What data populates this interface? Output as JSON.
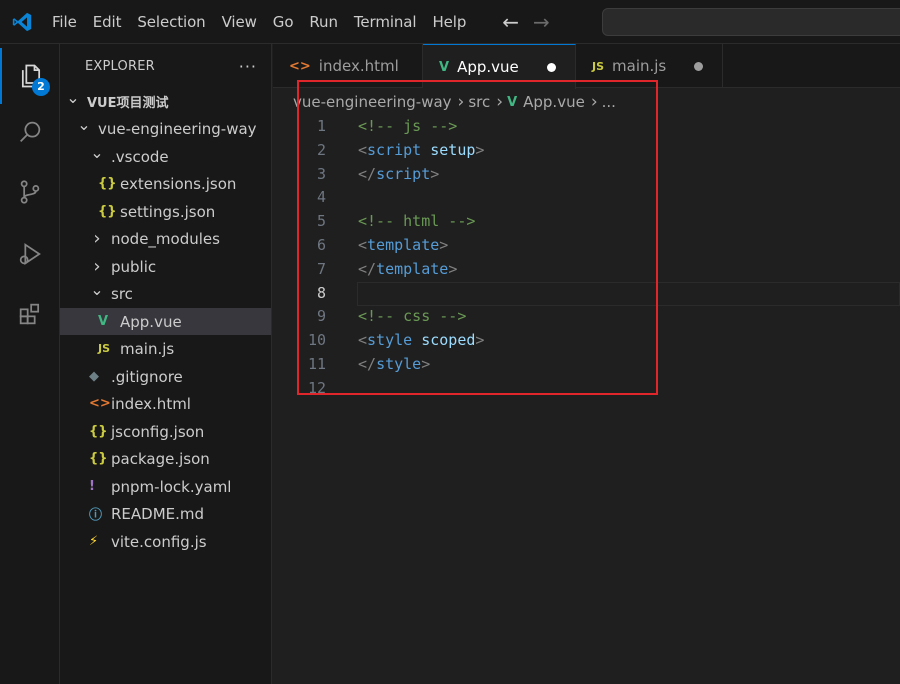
{
  "colors": {
    "accent": "#0078d4",
    "vue": "#41b883",
    "js": "#cbcb41",
    "html": "#e37933",
    "json": "#cbcb41",
    "annotation": "#e0262b"
  },
  "menu": [
    "File",
    "Edit",
    "Selection",
    "View",
    "Go",
    "Run",
    "Terminal",
    "Help"
  ],
  "activity": {
    "explorer_badge": "2",
    "icons": [
      "files-icon",
      "search-icon",
      "source-control-icon",
      "run-debug-icon",
      "extensions-icon"
    ]
  },
  "sidebar": {
    "title": "EXPLORER",
    "more": "···",
    "tree": [
      {
        "label": "VUE项目测试",
        "chevron": "down",
        "icon": "",
        "depth": 0,
        "root": true
      },
      {
        "label": "vue-engineering-way",
        "chevron": "down",
        "icon": "",
        "depth": 1
      },
      {
        "label": ".vscode",
        "chevron": "down",
        "icon": "",
        "depth": 2
      },
      {
        "label": "extensions.json",
        "chevron": "",
        "icon": "{}",
        "depth": 3
      },
      {
        "label": "settings.json",
        "chevron": "",
        "icon": "{}",
        "depth": 3
      },
      {
        "label": "node_modules",
        "chevron": "right",
        "icon": "",
        "depth": 2
      },
      {
        "label": "public",
        "chevron": "right",
        "icon": "",
        "depth": 2
      },
      {
        "label": "src",
        "chevron": "down",
        "icon": "",
        "depth": 2
      },
      {
        "label": "App.vue",
        "chevron": "",
        "icon": "V",
        "depth": 3,
        "selected": true
      },
      {
        "label": "main.js",
        "chevron": "",
        "icon": "JS",
        "depth": 3
      },
      {
        "label": ".gitignore",
        "chevron": "",
        "icon": "◆",
        "depth": 2
      },
      {
        "label": "index.html",
        "chevron": "",
        "icon": "<>",
        "depth": 2
      },
      {
        "label": "jsconfig.json",
        "chevron": "",
        "icon": "{}",
        "depth": 2
      },
      {
        "label": "package.json",
        "chevron": "",
        "icon": "{}",
        "depth": 2
      },
      {
        "label": "pnpm-lock.yaml",
        "chevron": "",
        "icon": "!",
        "depth": 2
      },
      {
        "label": "README.md",
        "chevron": "",
        "icon": "ⓘ",
        "depth": 2
      },
      {
        "label": "vite.config.js",
        "chevron": "",
        "icon": "⚡",
        "depth": 2
      }
    ]
  },
  "tabs": [
    {
      "label": "index.html",
      "icon": "<>",
      "active": false,
      "dirty": false
    },
    {
      "label": "App.vue",
      "icon": "V",
      "active": true,
      "dirty": true
    },
    {
      "label": "main.js",
      "icon": "JS",
      "active": false,
      "dirty": true
    }
  ],
  "breadcrumb": [
    "vue-engineering-way",
    "src",
    "App.vue",
    "..."
  ],
  "code": [
    {
      "n": "1",
      "tokens": [
        [
          "comment",
          "<!-- js -->"
        ]
      ]
    },
    {
      "n": "2",
      "tokens": [
        [
          "punct",
          "<"
        ],
        [
          "tag",
          "script"
        ],
        [
          "plain",
          " "
        ],
        [
          "attr",
          "setup"
        ],
        [
          "punct",
          ">"
        ]
      ]
    },
    {
      "n": "3",
      "tokens": [
        [
          "punct",
          "</"
        ],
        [
          "tag",
          "script"
        ],
        [
          "punct",
          ">"
        ]
      ]
    },
    {
      "n": "4",
      "tokens": []
    },
    {
      "n": "5",
      "tokens": [
        [
          "comment",
          "<!-- html -->"
        ]
      ]
    },
    {
      "n": "6",
      "tokens": [
        [
          "punct",
          "<"
        ],
        [
          "tag",
          "template"
        ],
        [
          "punct",
          ">"
        ]
      ]
    },
    {
      "n": "7",
      "tokens": [
        [
          "punct",
          "</"
        ],
        [
          "tag",
          "template"
        ],
        [
          "punct",
          ">"
        ]
      ]
    },
    {
      "n": "8",
      "tokens": [],
      "current": true
    },
    {
      "n": "9",
      "tokens": [
        [
          "comment",
          "<!-- css -->"
        ]
      ]
    },
    {
      "n": "10",
      "tokens": [
        [
          "punct",
          "<"
        ],
        [
          "tag",
          "style"
        ],
        [
          "plain",
          " "
        ],
        [
          "attr",
          "scoped"
        ],
        [
          "punct",
          ">"
        ]
      ]
    },
    {
      "n": "11",
      "tokens": [
        [
          "punct",
          "</"
        ],
        [
          "tag",
          "style"
        ],
        [
          "punct",
          ">"
        ]
      ]
    },
    {
      "n": "12",
      "tokens": []
    }
  ]
}
